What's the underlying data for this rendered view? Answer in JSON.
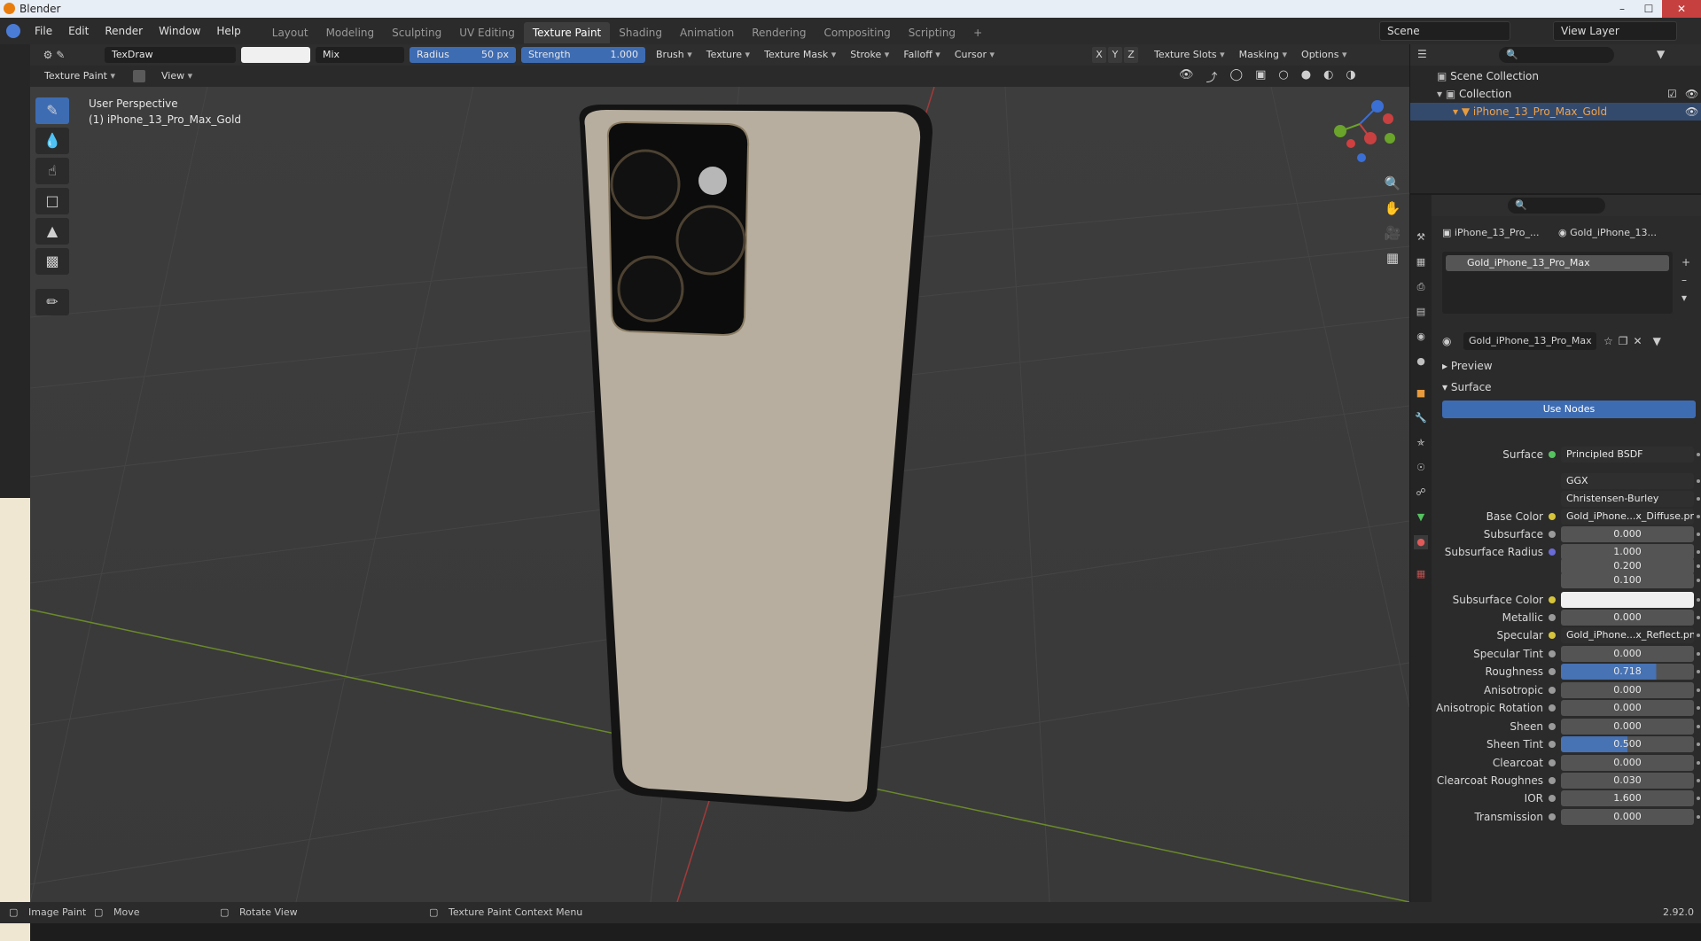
{
  "window": {
    "title": "Blender"
  },
  "menu": [
    "File",
    "Edit",
    "Render",
    "Window",
    "Help"
  ],
  "workspaces": [
    "Layout",
    "Modeling",
    "Sculpting",
    "UV Editing",
    "Texture Paint",
    "Shading",
    "Animation",
    "Rendering",
    "Compositing",
    "Scripting"
  ],
  "active_workspace": "Texture Paint",
  "scene": "Scene",
  "view_layer": "View Layer",
  "tool_header": {
    "brush_name": "TexDraw",
    "blend": "Mix",
    "radius_label": "Radius",
    "radius_value": "50 px",
    "strength_label": "Strength",
    "strength_value": "1.000",
    "dropdowns": [
      "Brush",
      "Texture",
      "Texture Mask",
      "Stroke",
      "Falloff",
      "Cursor"
    ],
    "axes": [
      "X",
      "Y",
      "Z"
    ],
    "right_dropdowns": [
      "Texture Slots",
      "Masking",
      "Options"
    ]
  },
  "mode_header": {
    "mode": "Texture Paint",
    "view": "View"
  },
  "viewport": {
    "line1": "User Perspective",
    "line2": "(1) iPhone_13_Pro_Max_Gold"
  },
  "outliner": {
    "scene_collection": "Scene Collection",
    "collection": "Collection",
    "object": "iPhone_13_Pro_Max_Gold"
  },
  "properties": {
    "breadcrumb_object": "iPhone_13_Pro_...",
    "breadcrumb_material": "Gold_iPhone_13...",
    "slot": "Gold_iPhone_13_Pro_Max",
    "material_name": "Gold_iPhone_13_Pro_Max",
    "preview": "Preview",
    "surface_section": "Surface",
    "use_nodes": "Use Nodes",
    "rows": [
      {
        "label": "Surface",
        "value": "Principled BSDF",
        "dot": "green",
        "kind": "text"
      },
      {
        "label": "",
        "value": "GGX",
        "dot": "",
        "kind": "text"
      },
      {
        "label": "",
        "value": "Christensen-Burley",
        "dot": "",
        "kind": "text"
      },
      {
        "label": "Base Color",
        "value": "Gold_iPhone...x_Diffuse.png",
        "dot": "yellow",
        "kind": "text"
      },
      {
        "label": "Subsurface",
        "value": "0.000",
        "dot": "grey",
        "kind": "num"
      },
      {
        "label": "Subsurface Radius",
        "value": "1.000",
        "dot": "purple",
        "kind": "num"
      },
      {
        "label": "",
        "value": "0.200",
        "dot": "",
        "kind": "num"
      },
      {
        "label": "",
        "value": "0.100",
        "dot": "",
        "kind": "num"
      },
      {
        "label": "Subsurface Color",
        "value": "",
        "dot": "yellow",
        "kind": "white"
      },
      {
        "label": "Metallic",
        "value": "0.000",
        "dot": "grey",
        "kind": "num"
      },
      {
        "label": "Specular",
        "value": "Gold_iPhone...x_Reflect.pn",
        "dot": "yellow",
        "kind": "text"
      },
      {
        "label": "Specular Tint",
        "value": "0.000",
        "dot": "grey",
        "kind": "num"
      },
      {
        "label": "Roughness",
        "value": "0.718",
        "dot": "grey",
        "kind": "blue",
        "fill": 0.718
      },
      {
        "label": "Anisotropic",
        "value": "0.000",
        "dot": "grey",
        "kind": "num"
      },
      {
        "label": "Anisotropic Rotation",
        "value": "0.000",
        "dot": "grey",
        "kind": "num"
      },
      {
        "label": "Sheen",
        "value": "0.000",
        "dot": "grey",
        "kind": "num"
      },
      {
        "label": "Sheen Tint",
        "value": "0.500",
        "dot": "grey",
        "kind": "blue",
        "fill": 0.5
      },
      {
        "label": "Clearcoat",
        "value": "0.000",
        "dot": "grey",
        "kind": "num"
      },
      {
        "label": "Clearcoat Roughnes",
        "value": "0.030",
        "dot": "grey",
        "kind": "num"
      },
      {
        "label": "IOR",
        "value": "1.600",
        "dot": "grey",
        "kind": "num"
      },
      {
        "label": "Transmission",
        "value": "0.000",
        "dot": "grey",
        "kind": "num"
      }
    ]
  },
  "status": {
    "left": "Image Paint",
    "move": "Move",
    "rotate": "Rotate View",
    "context": "Texture Paint Context Menu",
    "version": "2.92.0"
  }
}
